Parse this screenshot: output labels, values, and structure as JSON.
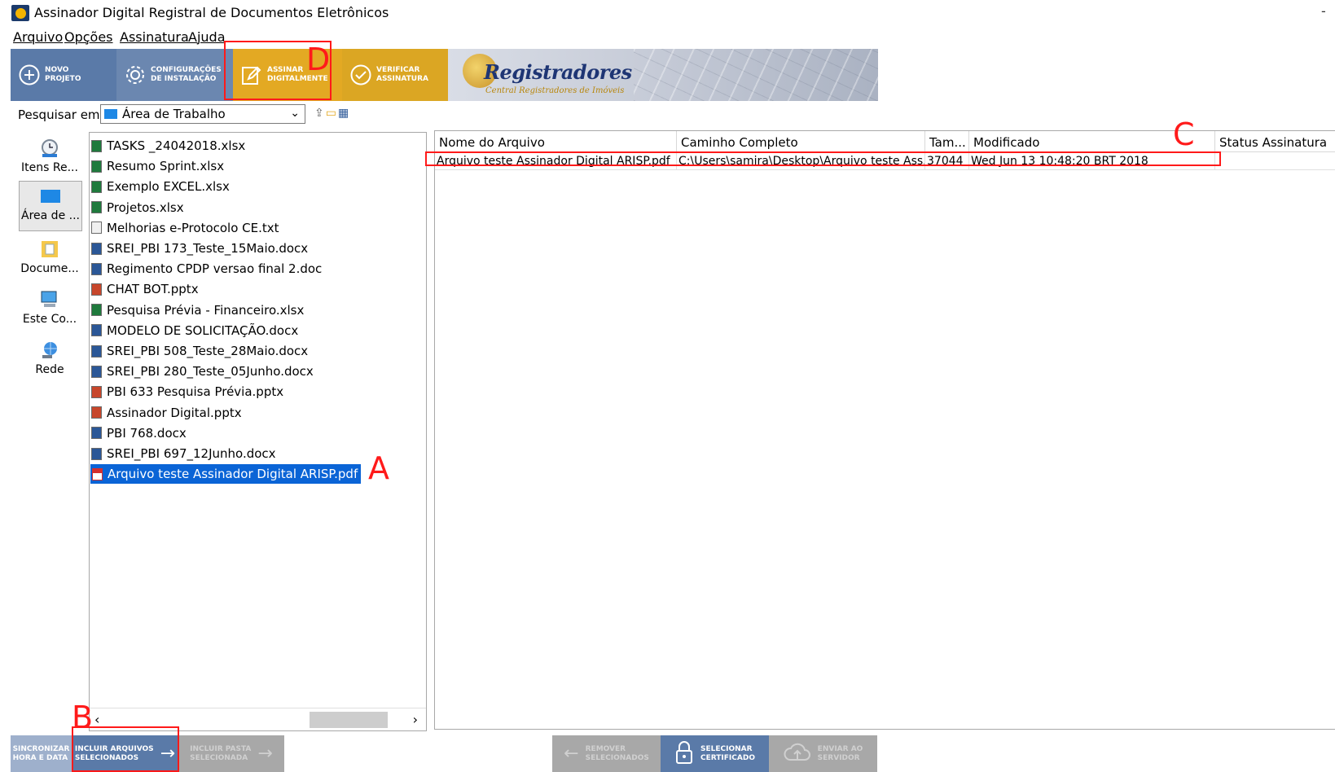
{
  "window": {
    "title": "Assinador Digital Registral de Documentos Eletrônicos",
    "minimize": "-"
  },
  "menu": {
    "items": [
      "Arquivo",
      "Opções",
      "Assinatura",
      "Ajuda"
    ]
  },
  "toolbar": {
    "novo": [
      "NOVO",
      "PROJETO"
    ],
    "config": [
      "CONFIGURAÇÕES",
      "DE INSTALAÇÃO"
    ],
    "assinar": [
      "ASSINAR",
      "DIGITALMENTE"
    ],
    "verificar": [
      "VERIFICAR",
      "ASSINATURA"
    ],
    "banner_title": "Registradores",
    "banner_subtitle": "Central Registradores de Imóveis"
  },
  "search": {
    "label": "Pesquisar em:",
    "value": "Área de Trabalho"
  },
  "places": [
    "Itens Re...",
    "Área de ...",
    "Docume...",
    "Este Co...",
    "Rede"
  ],
  "files": [
    {
      "name": "TASKS _24042018.xlsx",
      "type": "x"
    },
    {
      "name": "Resumo Sprint.xlsx",
      "type": "x"
    },
    {
      "name": "Exemplo EXCEL.xlsx",
      "type": "x"
    },
    {
      "name": "Projetos.xlsx",
      "type": "x"
    },
    {
      "name": "Melhorias e-Protocolo CE.txt",
      "type": "t"
    },
    {
      "name": "SREI_PBI 173_Teste_15Maio.docx",
      "type": "w"
    },
    {
      "name": "Regimento CPDP versao final 2.doc",
      "type": "w"
    },
    {
      "name": "CHAT BOT.pptx",
      "type": "p"
    },
    {
      "name": "Pesquisa Prévia - Financeiro.xlsx",
      "type": "x"
    },
    {
      "name": "MODELO DE SOLICITAÇÃO.docx",
      "type": "w"
    },
    {
      "name": "SREI_PBI 508_Teste_28Maio.docx",
      "type": "w"
    },
    {
      "name": "SREI_PBI 280_Teste_05Junho.docx",
      "type": "w"
    },
    {
      "name": "PBI 633 Pesquisa Prévia.pptx",
      "type": "p"
    },
    {
      "name": "Assinador Digital.pptx",
      "type": "p"
    },
    {
      "name": "PBI 768.docx",
      "type": "w"
    },
    {
      "name": "SREI_PBI 697_12Junho.docx",
      "type": "w"
    },
    {
      "name": "Arquivo teste Assinador Digital ARISP.pdf",
      "type": "pdf",
      "selected": true
    }
  ],
  "table": {
    "columns": [
      "Nome do Arquivo",
      "Caminho Completo",
      "Tam...",
      "Modificado",
      "Status Assinatura"
    ],
    "rows": [
      [
        "Arquivo teste Assinador Digital ARISP.pdf",
        "C:\\Users\\samira\\Desktop\\Arquivo teste Ass...",
        "37044",
        "Wed Jun 13 10:48:20 BRT 2018",
        ""
      ]
    ]
  },
  "bottom": {
    "sincronizar": [
      "SINCRONIZAR",
      "HORA E DATA"
    ],
    "incluir": [
      "INCLUIR ARQUIVOS",
      "SELECIONADOS"
    ],
    "incluir_pasta": [
      "INCLUIR PASTA",
      "SELECIONADA"
    ],
    "remover": [
      "REMOVER",
      "SELECIONADOS"
    ],
    "selecionar": [
      "SELECIONAR",
      "CERTIFICADO"
    ],
    "enviar": [
      "ENVIAR AO",
      "SERVIDOR"
    ]
  },
  "annotations": [
    "A",
    "B",
    "C",
    "D"
  ],
  "colors": {
    "toolbar_blue": "#5a7aa8",
    "toolbar_gold": "#e3a923",
    "selection": "#0a64d6",
    "annotation_red": "#ff1a1a"
  }
}
